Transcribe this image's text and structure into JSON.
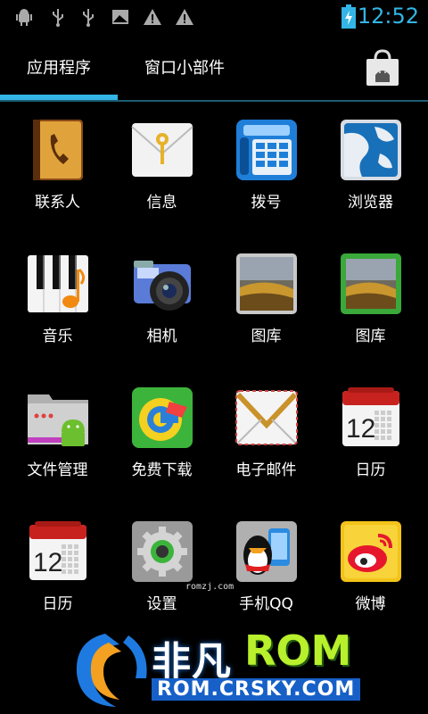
{
  "status_bar": {
    "time": "12:52",
    "icons": [
      "android-debug-icon",
      "usb-icon",
      "usb-icon",
      "image-notification-icon",
      "warning-icon",
      "warning-icon",
      "battery-charging-icon"
    ]
  },
  "tabs": [
    {
      "label": "应用程序",
      "selected": true
    },
    {
      "label": "窗口小部件",
      "selected": false
    }
  ],
  "store_icon": "play-store-bag-icon",
  "apps": [
    {
      "label": "联系人",
      "icon": "contacts-icon"
    },
    {
      "label": "信息",
      "icon": "messaging-icon"
    },
    {
      "label": "拨号",
      "icon": "phone-dialer-icon"
    },
    {
      "label": "浏览器",
      "icon": "browser-icon"
    },
    {
      "label": "音乐",
      "icon": "music-icon"
    },
    {
      "label": "相机",
      "icon": "camera-icon"
    },
    {
      "label": "图库",
      "icon": "gallery-icon"
    },
    {
      "label": "图库",
      "icon": "gallery-green-icon"
    },
    {
      "label": "文件管理",
      "icon": "file-manager-icon"
    },
    {
      "label": "免费下载",
      "icon": "free-download-icon"
    },
    {
      "label": "电子邮件",
      "icon": "email-icon"
    },
    {
      "label": "日历",
      "icon": "calendar-icon"
    },
    {
      "label": "日历",
      "icon": "calendar-icon"
    },
    {
      "label": "设置",
      "icon": "settings-icon"
    },
    {
      "label": "手机QQ",
      "icon": "qq-icon"
    },
    {
      "label": "微博",
      "icon": "weibo-icon"
    }
  ],
  "calendar_day": "12",
  "watermark": {
    "small": "romzj.com",
    "brand_cn": "非凡",
    "brand_rom": "ROM",
    "url": "ROM.CRSKY.COM"
  },
  "colors": {
    "accent": "#33b5e5",
    "background": "#000000"
  }
}
